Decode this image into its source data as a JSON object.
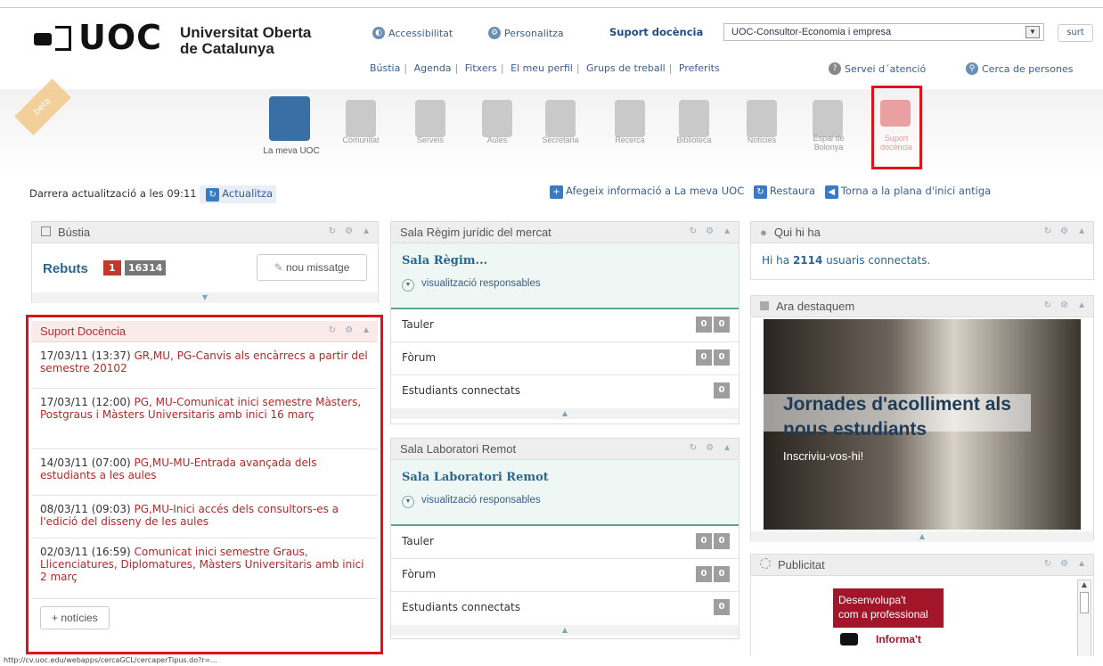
{
  "header": {
    "logo_text": "UOC",
    "university_line1": "Universitat Oberta",
    "university_line2": "de Catalunya",
    "accessibility": "Accessibilitat",
    "personalize": "Personalitza",
    "support_tab": "Suport docència",
    "profile_select": "UOC-Consultor-Economia i empresa",
    "logout": "surt",
    "links": [
      "Bústia",
      "Agenda",
      "Fitxers",
      "El meu perfil",
      "Grups de treball",
      "Preferits"
    ],
    "service": "Servei d´atenció",
    "search_people": "Cerca de persones"
  },
  "beta": "beta",
  "nav_icons": [
    {
      "label": "La meva UOC"
    },
    {
      "label": "Comunitat"
    },
    {
      "label": "Serveis"
    },
    {
      "label": "Aules"
    },
    {
      "label": "Secretaria"
    },
    {
      "label": "Recerca"
    },
    {
      "label": "Biblioteca"
    },
    {
      "label": "Notícies"
    },
    {
      "label": "Espai de Bolonya"
    },
    {
      "label": "Suport docència"
    }
  ],
  "update_bar": {
    "last_update": "Darrera actualització a les 09:11",
    "refresh": "Actualitza",
    "add_info": "Afegeix informació a La meva UOC",
    "restore": "Restaura",
    "back_old": "Torna a la plana d'inici antiga"
  },
  "bustia": {
    "title": "Bústia",
    "received_label": "Rebuts",
    "unread": "1",
    "total": "16314",
    "new_message": "nou missatge"
  },
  "suport": {
    "title": "Suport Docència",
    "items": [
      {
        "date": "17/03/11 (13:37)",
        "text": "GR,MU, PG-Canvis als encàrrecs a partir del semestre 20102"
      },
      {
        "date": "17/03/11 (12:00)",
        "text": "PG, MU-Comunicat inici semestre Màsters, Postgraus i Màsters Universitaris amb inici 16 març"
      },
      {
        "date": "14/03/11 (07:00)",
        "text": "PG,MU-MU-Entrada avançada dels estudiants a les aules"
      },
      {
        "date": "08/03/11 (09:03)",
        "text": "PG,MU-Inici accés dels consultors-es a l'edició del disseny de les aules"
      },
      {
        "date": "02/03/11 (16:59)",
        "text": "Comunicat inici semestre Graus, Llicenciatures, Diplomatures, Màsters Universitaris amb inici 2 març"
      }
    ],
    "more": "+ notícies"
  },
  "sala1": {
    "header": "Sala Règim jurídic del mercat",
    "title": "Sala Règim...",
    "responsables": "visualització responsables",
    "tauler": "Tauler",
    "tauler_a": "0",
    "tauler_b": "0",
    "forum": "Fòrum",
    "forum_a": "0",
    "forum_b": "0",
    "students": "Estudiants connectats",
    "students_n": "0"
  },
  "sala2": {
    "header": "Sala Laboratori Remot",
    "title": "Sala Laboratori Remot",
    "responsables": "visualització responsables",
    "tauler": "Tauler",
    "tauler_a": "0",
    "tauler_b": "0",
    "forum": "Fòrum",
    "forum_a": "0",
    "forum_b": "0",
    "students": "Estudiants connectats",
    "students_n": "0"
  },
  "quihiha": {
    "title": "Qui hi ha",
    "text_before": "Hi ha ",
    "count": "2114",
    "text_after": " usuaris connectats."
  },
  "destaquem": {
    "title": "Ara destaquem",
    "headline": "Jornades d'acolliment als nous estudiants",
    "cta": "Inscriviu-vos-hi!"
  },
  "publicitat": {
    "title": "Publicitat",
    "ad_line1": "Desenvolupa't",
    "ad_line2": "com a professional",
    "ad_cta": "Informa't"
  },
  "status_url": "http://cv.uoc.edu/webapps/cercaGCL/cercaperTipus.do?r=..."
}
